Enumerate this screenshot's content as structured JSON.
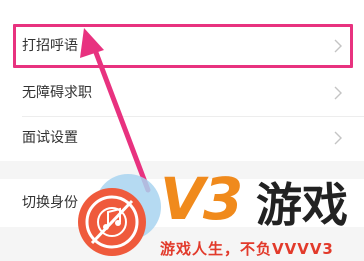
{
  "menu": {
    "items": [
      {
        "label": "打招呼语",
        "chevron_icon": "chevron-right-icon"
      },
      {
        "label": "无障碍求职",
        "chevron_icon": "chevron-right-icon"
      },
      {
        "label": "面试设置",
        "chevron_icon": "chevron-right-icon"
      },
      {
        "label": "切换身份",
        "chevron_icon": "chevron-right-icon"
      }
    ]
  },
  "annotation": {
    "color": "#e8327f",
    "arrow_icon": "arrow-icon"
  },
  "watermark": {
    "brand": "V3游戏",
    "brand_v3": "V3",
    "brand_cn": "游戏",
    "slogan": "游戏人生，不负VVVV3",
    "logo_icon": "music-disc-logo-icon",
    "colors": {
      "primary": "#f08a1c",
      "dark": "#222222",
      "red": "#e23a2b"
    }
  }
}
